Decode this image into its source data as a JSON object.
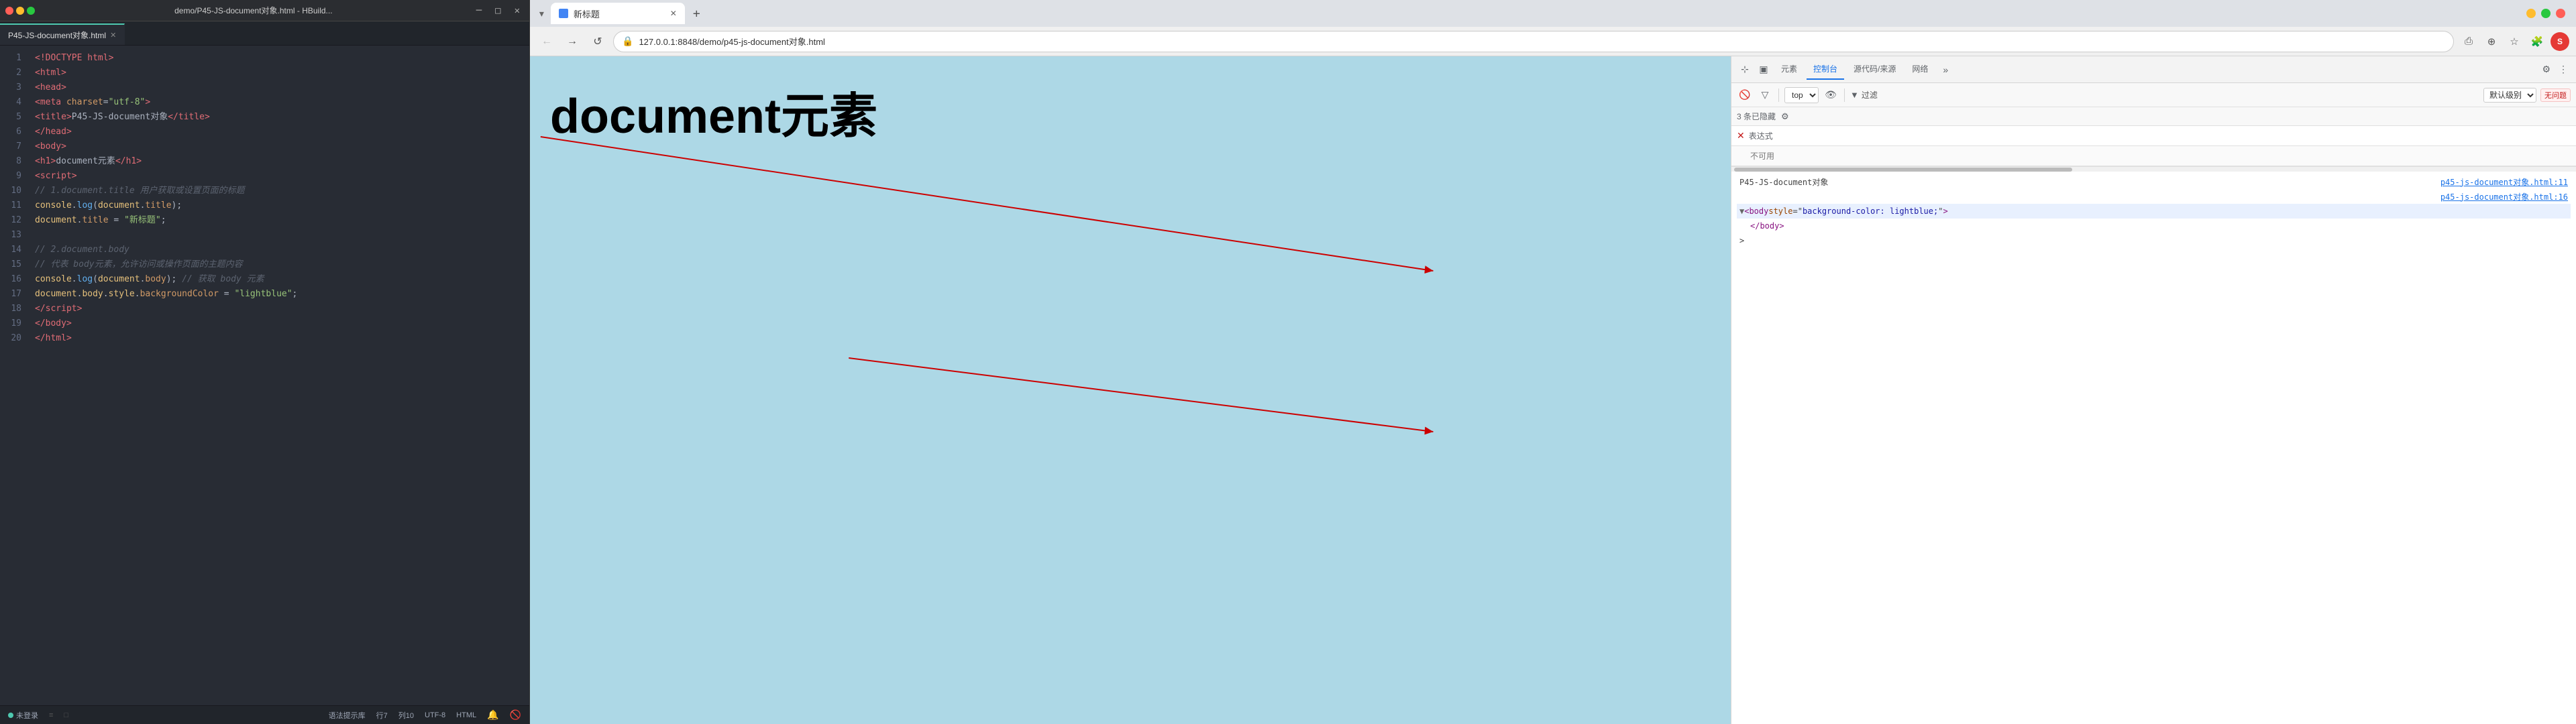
{
  "editor": {
    "titlebar": {
      "title": "demo/P45-JS-document对象.html - HBuild...",
      "close_label": "✕",
      "minimize_label": "─",
      "maximize_label": "□"
    },
    "tab": {
      "label": "P45-JS-document对象.html"
    },
    "lines": [
      {
        "num": "1",
        "html": "<span class='punc'>  </span><span class='tag'>&lt;!DOCTYPE html&gt;</span>"
      },
      {
        "num": "2",
        "html": "<span class='punc'></span><span class='tag'>&lt;html&gt;</span>"
      },
      {
        "num": "3",
        "html": "<span class='punc'>  </span><span class='tag'>&lt;head&gt;</span>"
      },
      {
        "num": "4",
        "html": "<span class='punc'>      </span><span class='tag'>&lt;meta</span> <span class='attr'>charset</span><span class='punc'>=</span><span class='str'>\"utf-8\"</span><span class='tag'>&gt;</span>"
      },
      {
        "num": "5",
        "html": "<span class='punc'>      </span><span class='tag'>&lt;title&gt;</span><span class='punc'>P45-JS-document对象</span><span class='tag'>&lt;/title&gt;</span>"
      },
      {
        "num": "6",
        "html": "<span class='punc'>  </span><span class='tag'>&lt;/head&gt;</span>"
      },
      {
        "num": "7",
        "html": "<span class='punc'>  </span><span class='tag'>&lt;body&gt;</span>"
      },
      {
        "num": "8",
        "html": "<span class='punc'>      </span><span class='tag'>&lt;h1&gt;</span><span class='punc'>document元素</span><span class='tag'>&lt;/h1&gt;</span>"
      },
      {
        "num": "9",
        "html": "<span class='punc'>      </span><span class='tag'>&lt;script&gt;</span>"
      },
      {
        "num": "10",
        "html": "<span class='cmt'>          // 1.document.title  用户获取或设置页面的标题</span>"
      },
      {
        "num": "11",
        "html": "<span class='punc'>          </span><span class='obj'>console</span><span class='punc'>.</span><span class='fn'>log</span><span class='punc'>(</span><span class='obj'>document</span><span class='punc'>.</span><span class='attr'>title</span><span class='punc'>);</span>"
      },
      {
        "num": "12",
        "html": "<span class='punc'>          </span><span class='obj'>document</span><span class='punc'>.</span><span class='attr'>title</span> <span class='punc'>= </span><span class='str'>\"新标题\"</span><span class='punc'>;</span>"
      },
      {
        "num": "13",
        "html": ""
      },
      {
        "num": "14",
        "html": "<span class='cmt'>          // 2.document.body</span>"
      },
      {
        "num": "15",
        "html": "<span class='cmt'>          // 代表 body元素，允许访问或操作页面的主题内容</span>"
      },
      {
        "num": "16",
        "html": "<span class='punc'>          </span><span class='obj'>console</span><span class='punc'>.</span><span class='fn'>log</span><span class='punc'>(</span><span class='obj'>document</span><span class='punc'>.</span><span class='attr'>body</span><span class='punc'>); </span><span class='cmt'>// 获取 body 元素</span>"
      },
      {
        "num": "17",
        "html": "<span class='punc'>          </span><span class='obj'>document</span><span class='punc'>.</span><span class='obj'>body</span><span class='punc'>.</span><span class='obj'>style</span><span class='punc'>.</span><span class='attr'>backgroundColor</span> <span class='punc'>= </span><span class='str'>\"lightblue\"</span><span class='punc'>;</span>"
      },
      {
        "num": "18",
        "html": "<span class='punc'>      </span><span class='tag'>&lt;/script&gt;</span>"
      },
      {
        "num": "19",
        "html": "<span class='punc'>  </span><span class='tag'>&lt;/body&gt;</span>"
      },
      {
        "num": "20",
        "html": "<span class='tag'>&lt;/html&gt;</span>"
      }
    ],
    "statusbar": {
      "login": "未登录",
      "hint": "语法提示库",
      "row": "行7",
      "col": "列10",
      "encoding": "UTF-8",
      "filetype": "HTML"
    }
  },
  "browser": {
    "tab": {
      "title": "新标题",
      "close": "✕",
      "new_tab": "+"
    },
    "address": "127.0.0.1:8848/demo/p45-js-document对象.html",
    "page": {
      "h1": "document元素"
    },
    "devtools": {
      "tabs": [
        "元素",
        "控制台",
        "源代码/来源",
        "网络"
      ],
      "active_tab": "控制台",
      "secondary_toolbar": {
        "top_label": "top",
        "filter_placeholder": "过滤",
        "default_level": "默认级别",
        "no_issues": "无问题"
      },
      "info_bar": "3 条已隐藏",
      "expression_label": "表达式",
      "expression_value": "不可用",
      "dom_lines": [
        {
          "indent": 0,
          "content": "P45-JS-document对象",
          "link": "p45-js-document对象.html:11"
        },
        {
          "indent": 0,
          "content": "",
          "link": "p45-js-document对象.html:16"
        },
        {
          "indent": 0,
          "body_open": true,
          "text": "▼ <body style=\"background-color: lightblue;\">"
        },
        {
          "indent": 1,
          "text": "</body>"
        },
        {
          "indent": 0,
          "text": ">"
        }
      ]
    }
  },
  "icons": {
    "back": "←",
    "forward": "→",
    "reload": "↺",
    "lock": "🔒",
    "star": "☆",
    "extensions": "🧩",
    "more_vert": "⋮",
    "screenshot": "⎙",
    "zoom": "⊕",
    "translate": "A",
    "settings": "⚙",
    "close_x": "✕",
    "filter": "▼",
    "eye": "👁",
    "cursor": "⊹",
    "box_model": "▣",
    "expand_more": "»"
  }
}
